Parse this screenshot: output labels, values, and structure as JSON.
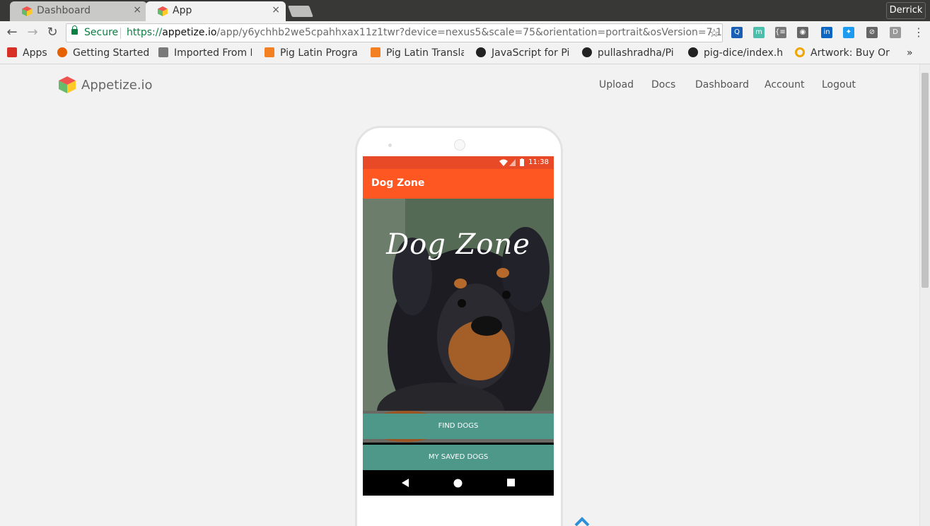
{
  "tabs": [
    {
      "title": "Dashboard",
      "close": "×"
    },
    {
      "title": "App",
      "close": "×"
    }
  ],
  "profile": {
    "name": "Derrick"
  },
  "toolbar": {
    "back": "←",
    "forward": "→",
    "reload": "↻",
    "secure_label": "Secure",
    "url_scheme": "https://",
    "url_host": "appetize.io",
    "url_path": "/app/y6ychhb2we5cpahhxax11z1twr?device=nexus5&scale=75&orientation=portrait&osVersion=7.1",
    "star": "☆"
  },
  "extensions": [
    {
      "icon": "magnifier-extension-icon",
      "glyph": "Q",
      "color": "#1a5fb4"
    },
    {
      "icon": "m-extension-icon",
      "glyph": "m",
      "color": "#4bbfab"
    },
    {
      "icon": "json-extension-icon",
      "glyph": "{≡}",
      "color": "#777777"
    },
    {
      "icon": "eye-extension-icon",
      "glyph": "◉",
      "color": "#666666"
    },
    {
      "icon": "linkedin-icon",
      "glyph": "in",
      "color": "#0a66c2"
    },
    {
      "icon": "bird-extension-icon",
      "glyph": "✦",
      "color": "#1d9bf0"
    },
    {
      "icon": "no-eye-extension-icon",
      "glyph": "⊘",
      "color": "#666666"
    },
    {
      "icon": "d-extension-icon",
      "glyph": "D",
      "color": "#999999"
    },
    {
      "icon": "menu-icon",
      "glyph": "⋮",
      "color": "#555555"
    }
  ],
  "bookmarks": [
    {
      "label": "Apps",
      "icon": "apps-grid-icon",
      "color": "#d93025"
    },
    {
      "label": "Getting Started",
      "icon": "firefox-icon",
      "color": "#e66000"
    },
    {
      "label": "Imported From F",
      "icon": "folder-icon",
      "color": "#7a7a7a"
    },
    {
      "label": "Pig Latin Progra",
      "icon": "stackoverflow-icon",
      "color": "#f48024"
    },
    {
      "label": "Pig Latin Transla",
      "icon": "stackoverflow-icon",
      "color": "#f48024"
    },
    {
      "label": "JavaScript for Pi",
      "icon": "github-icon",
      "color": "#222222"
    },
    {
      "label": "pullashradha/Pi",
      "icon": "github-icon",
      "color": "#222222"
    },
    {
      "label": "pig-dice/index.h",
      "icon": "github-icon",
      "color": "#222222"
    },
    {
      "label": "Artwork: Buy Or",
      "icon": "ring-icon",
      "color": "#f0a500"
    }
  ],
  "bookmarks_more": "»",
  "site": {
    "brand": "Appetize.io",
    "nav": [
      "Upload",
      "Docs",
      "Dashboard",
      "Account",
      "Logout"
    ]
  },
  "app": {
    "time": "11:38",
    "title": "Dog Zone",
    "hero_title": "Dog Zone",
    "find_button": "FIND DOGS",
    "saved_button": "MY SAVED DOGS",
    "primary_color": "#fe5722",
    "button_color": "#4e988a"
  }
}
